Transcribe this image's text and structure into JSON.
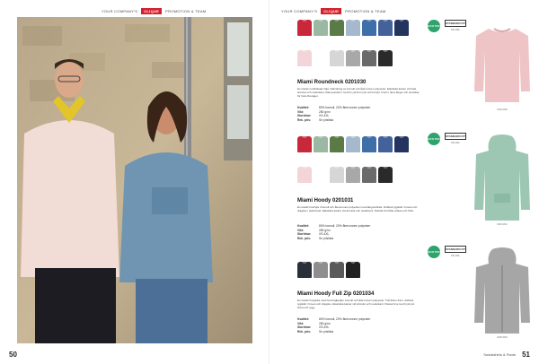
{
  "header": {
    "left_text": "YOUR COMPANY'S",
    "brand": "CLIQUE",
    "right_text": "PROMOTION & TEAM"
  },
  "left_page": {
    "page_number": "50"
  },
  "right_page": {
    "page_number": "51",
    "footer": "Sweatshirts & Pants",
    "colors": {
      "roundneck": [
        "#c8283a",
        "#9bb8a2",
        "#5a7a46",
        "#a5b8cc",
        "#3e6fa8",
        "#44629a",
        "#23355f"
      ],
      "roundneck2": [
        "#f3d4d8",
        "#ffffff",
        "#d6d6d6",
        "#a8a8a8",
        "#6a6a6a",
        "#2a2a2a"
      ],
      "hoody": [
        "#c8283a",
        "#9bb8a2",
        "#5a7a46",
        "#a5b8cc",
        "#3e6fa8",
        "#44629a",
        "#23355f"
      ],
      "hoody2": [
        "#f3d4d8",
        "#ffffff",
        "#d6d6d6",
        "#a8a8a8",
        "#6a6a6a",
        "#2a2a2a"
      ],
      "fullzip": [
        "#2b2f3a",
        "#8e8e8e",
        "#5a5a5a",
        "#222222"
      ]
    },
    "products": [
      {
        "title": "Miami Roundneck 0201030",
        "description": "En utsökt rundhalsad tröja i blandning av bomull och återvunnen polyester. Elastiska kanter vid hals, ärmslut och nederkant. Rak passform med fin yta för tryck och brodyr. Finns i flera färger och storlekar för hela företaget.",
        "specs": [
          {
            "k": "Kvalitet:",
            "v": "80% bomull, 20% återvunnen polyester"
          },
          {
            "k": "Vikt:",
            "v": "280 g/m²"
          },
          {
            "k": "Storlekar:",
            "v": "XS-4XL"
          },
          {
            "k": "Rek. pris:",
            "v": "Se prislista"
          }
        ],
        "eco": "ECO TEX",
        "std": "STANDARD FIT",
        "sizes": "XS-4XL",
        "garment_label": "0201030"
      },
      {
        "title": "Miami Hoody 0201031",
        "description": "En utsökt huvtröja i bomull och återvunnen polyester med känguruficka. Dubbelt tygskikt i huvan och dragsko i platt band. Elastiska kanter vid ärmslut och nederkant. Perfekt för både arbete och fritid.",
        "specs": [
          {
            "k": "Kvalitet:",
            "v": "80% bomull, 20% återvunnen polyester"
          },
          {
            "k": "Vikt:",
            "v": "280 g/m²"
          },
          {
            "k": "Storlekar:",
            "v": "XS-4XL"
          },
          {
            "k": "Rek. pris:",
            "v": "Se prislista"
          }
        ],
        "eco": "ECO TEX",
        "std": "STANDARD FIT",
        "sizes": "XS-4XL",
        "garment_label": "0201031"
      },
      {
        "title": "Miami Hoody Full Zip 0201034",
        "description": "En utsökt huvjacka med hel dragkedja i bomull och återvunnen polyester. Två fickor fram, dubbelt tygskikt i huvan och dragsko. Elastiska kanter vid ärmslut och nederkant. Passar bra med tryck på bröst och rygg.",
        "specs": [
          {
            "k": "Kvalitet:",
            "v": "80% bomull, 20% återvunnen polyester"
          },
          {
            "k": "Vikt:",
            "v": "280 g/m²"
          },
          {
            "k": "Storlekar:",
            "v": "XS-4XL"
          },
          {
            "k": "Rek. pris:",
            "v": "Se prislista"
          }
        ],
        "eco": "ECO TEX",
        "std": "STANDARD FIT",
        "sizes": "XS-4XL",
        "garment_label": "0201034"
      }
    ]
  }
}
